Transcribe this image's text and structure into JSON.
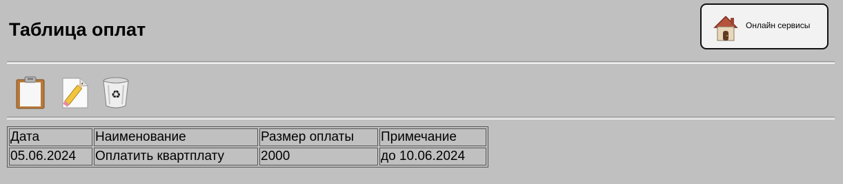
{
  "header": {
    "title": "Таблица оплат"
  },
  "online_services": {
    "label": "Онлайн сервисы",
    "icon": "house-icon"
  },
  "toolbar": [
    {
      "name": "clipboard-icon",
      "action": "add"
    },
    {
      "name": "edit-icon",
      "action": "edit"
    },
    {
      "name": "recycle-bin-icon",
      "action": "delete"
    }
  ],
  "table": {
    "headers": [
      "Дата",
      "Наименование",
      "Размер оплаты",
      "Примечание"
    ],
    "rows": [
      [
        "05.06.2024",
        "Оплатить квартплату",
        "2000",
        "до 10.06.2024"
      ]
    ]
  },
  "colors": {
    "background": "#c0c0c0",
    "button_background": "#f2f2f2"
  }
}
